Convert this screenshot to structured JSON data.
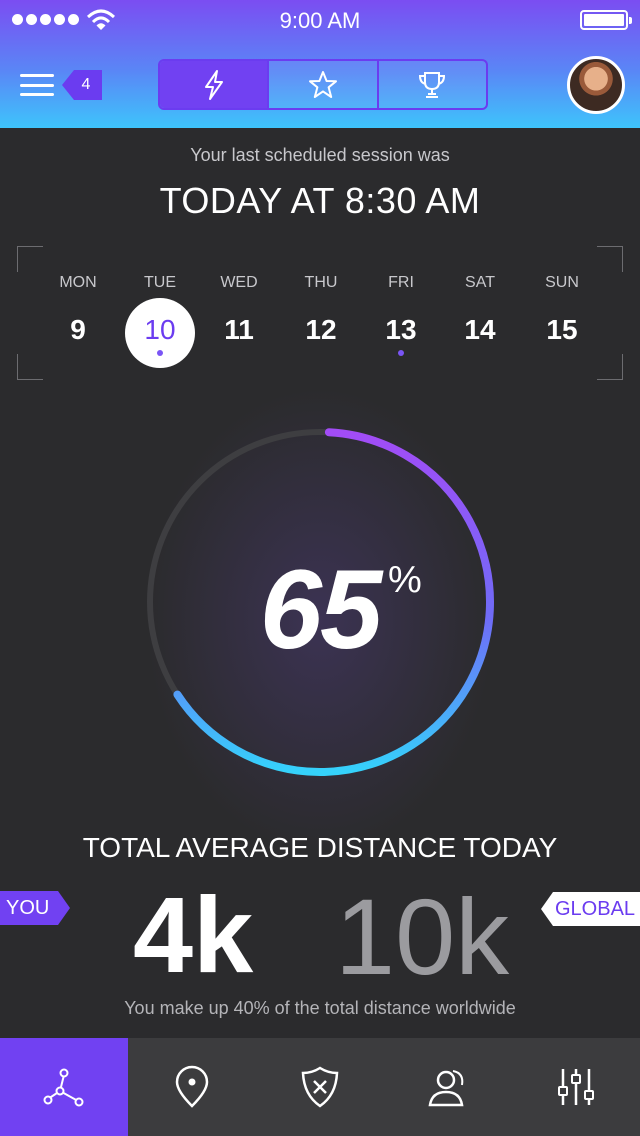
{
  "status_bar": {
    "time": "9:00 AM"
  },
  "header": {
    "notification_count": "4",
    "segments": [
      {
        "icon": "lightning-icon",
        "active": true
      },
      {
        "icon": "star-icon",
        "active": false
      },
      {
        "icon": "trophy-icon",
        "active": false
      }
    ]
  },
  "session": {
    "label": "Your last scheduled session was",
    "time": "TODAY AT 8:30 AM"
  },
  "week": {
    "days": [
      {
        "name": "MON",
        "num": "9"
      },
      {
        "name": "TUE",
        "num": "10",
        "selected": true,
        "dot": true
      },
      {
        "name": "WED",
        "num": "11"
      },
      {
        "name": "THU",
        "num": "12"
      },
      {
        "name": "FRI",
        "num": "13",
        "dot": true
      },
      {
        "name": "SAT",
        "num": "14"
      },
      {
        "name": "SUN",
        "num": "15"
      }
    ]
  },
  "progress": {
    "value": "65",
    "unit": "%",
    "fraction": 0.65
  },
  "distance": {
    "title": "TOTAL AVERAGE DISTANCE TODAY",
    "you_label": "YOU",
    "you_value": "4k",
    "global_label": "GLOBAL",
    "global_value": "10k",
    "note": "You make up 40% of the total distance worldwide"
  },
  "tabbar": {
    "items": [
      {
        "icon": "network-icon",
        "active": true
      },
      {
        "icon": "location-pin-icon",
        "active": false
      },
      {
        "icon": "shield-icon",
        "active": false
      },
      {
        "icon": "user-chat-icon",
        "active": false
      },
      {
        "icon": "sliders-icon",
        "active": false
      }
    ]
  },
  "colors": {
    "accent": "#7141f2",
    "gradient_start": "#7b4df2",
    "gradient_end": "#3ec4fb",
    "background": "#2b2b2d"
  }
}
